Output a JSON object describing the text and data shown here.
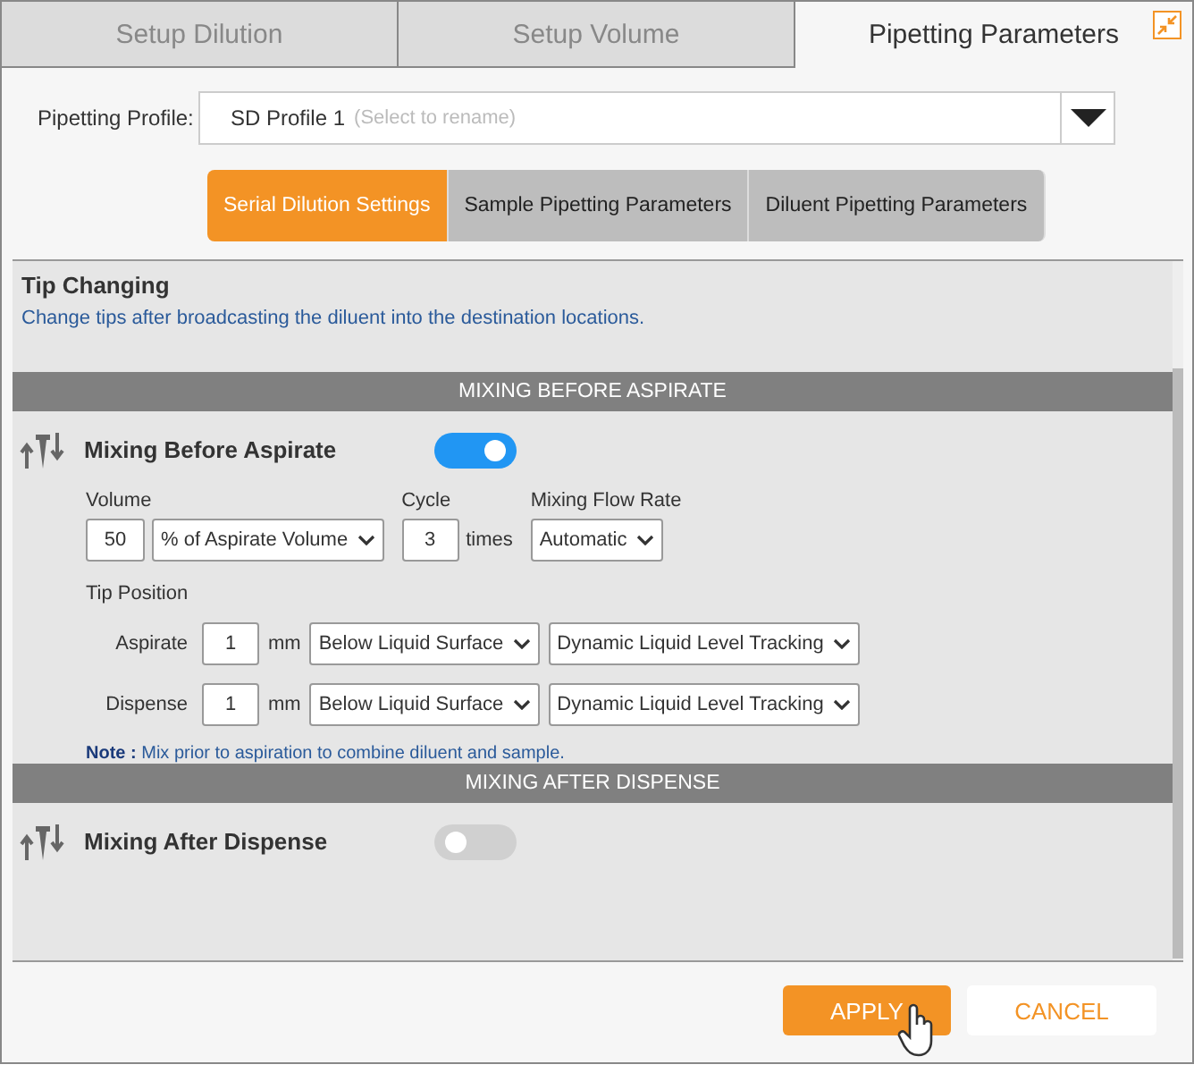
{
  "tabs": [
    {
      "label": "Setup Dilution",
      "selected": false
    },
    {
      "label": "Setup Volume",
      "selected": false
    },
    {
      "label": "Pipetting Parameters",
      "selected": true
    }
  ],
  "profile": {
    "label": "Pipetting Profile:",
    "value": "SD Profile 1",
    "hint": "(Select to rename)"
  },
  "subtabs": [
    {
      "label": "Serial Dilution Settings",
      "selected": true
    },
    {
      "label": "Sample Pipetting Parameters",
      "selected": false
    },
    {
      "label": "Diluent Pipetting Parameters",
      "selected": false
    }
  ],
  "tip_changing": {
    "title": "Tip Changing",
    "description": "Change tips after broadcasting the diluent into the destination locations."
  },
  "sections": [
    {
      "header": "MIXING BEFORE ASPIRATE",
      "title": "Mixing Before Aspirate",
      "on": true,
      "volume_label": "Volume",
      "volume": "50",
      "volume_unit": "% of Aspirate Volume",
      "cycle_label": "Cycle",
      "cycle": "3",
      "cycle_unit": "times",
      "flow_label": "Mixing Flow Rate",
      "flow": "Automatic",
      "tip_position_label": "Tip Position",
      "positions": [
        {
          "label": "Aspirate",
          "value": "1",
          "unit": "mm",
          "reference": "Below Liquid Surface",
          "tracking": "Dynamic Liquid Level Tracking"
        },
        {
          "label": "Dispense",
          "value": "1",
          "unit": "mm",
          "reference": "Below Liquid Surface",
          "tracking": "Dynamic Liquid Level Tracking"
        }
      ],
      "note_label": "Note :",
      "note": "Mix prior to aspiration to combine diluent and sample."
    },
    {
      "header": "MIXING AFTER DISPENSE",
      "title": "Mixing After Dispense",
      "on": false
    }
  ],
  "buttons": [
    {
      "label": "APPLY",
      "kind": "primary"
    },
    {
      "label": "CANCEL",
      "kind": "secondary"
    }
  ]
}
